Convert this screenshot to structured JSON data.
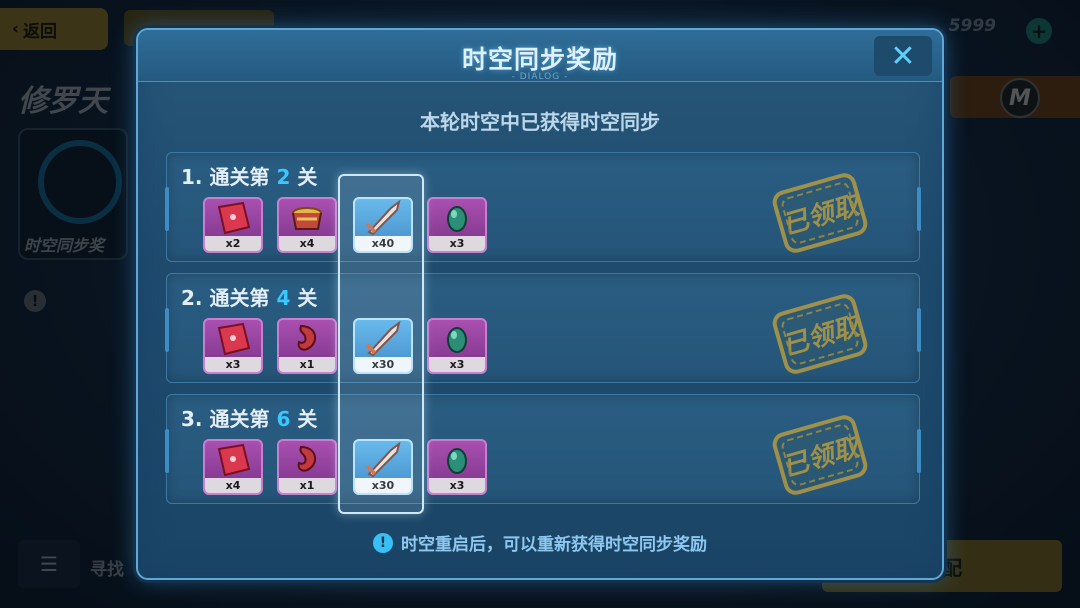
{
  "background": {
    "back_label": "返回",
    "currency_value": "5999",
    "left_title": "修罗天",
    "left_card_label": "时空同步奖",
    "search_label": "寻找",
    "match_label": "匹配"
  },
  "dialog": {
    "title": "时空同步奖励",
    "subtag": "- DIALOG -",
    "subtitle": "本轮时空中已获得时空同步",
    "footer_tip": "时空重启后，可以重新获得时空同步奖励"
  },
  "milestones": [
    {
      "index": "1.",
      "prefix": "通关第",
      "stage": "2",
      "suffix": "关",
      "stamp": "已领取",
      "rewards": [
        {
          "icon": "red-gem-icon",
          "count": "x2"
        },
        {
          "icon": "bowl-icon",
          "count": "x4"
        },
        {
          "icon": "sword-icon",
          "count": "x40"
        },
        {
          "icon": "green-egg-icon",
          "count": "x3"
        }
      ]
    },
    {
      "index": "2.",
      "prefix": "通关第",
      "stage": "4",
      "suffix": "关",
      "stamp": "已领取",
      "rewards": [
        {
          "icon": "red-gem-icon",
          "count": "x3"
        },
        {
          "icon": "red-horn-icon",
          "count": "x1"
        },
        {
          "icon": "sword-icon",
          "count": "x30"
        },
        {
          "icon": "green-egg-icon",
          "count": "x3"
        }
      ]
    },
    {
      "index": "3.",
      "prefix": "通关第",
      "stage": "6",
      "suffix": "关",
      "stamp": "已领取",
      "rewards": [
        {
          "icon": "red-gem-icon",
          "count": "x4"
        },
        {
          "icon": "red-horn-icon",
          "count": "x1"
        },
        {
          "icon": "sword-icon",
          "count": "x30"
        },
        {
          "icon": "green-egg-icon",
          "count": "x3"
        }
      ]
    }
  ],
  "colors": {
    "accent": "#38c7ff",
    "stamp": "#c7a43a",
    "purple_item": "#a94fb0",
    "blue_item": "#5ab6ee"
  }
}
